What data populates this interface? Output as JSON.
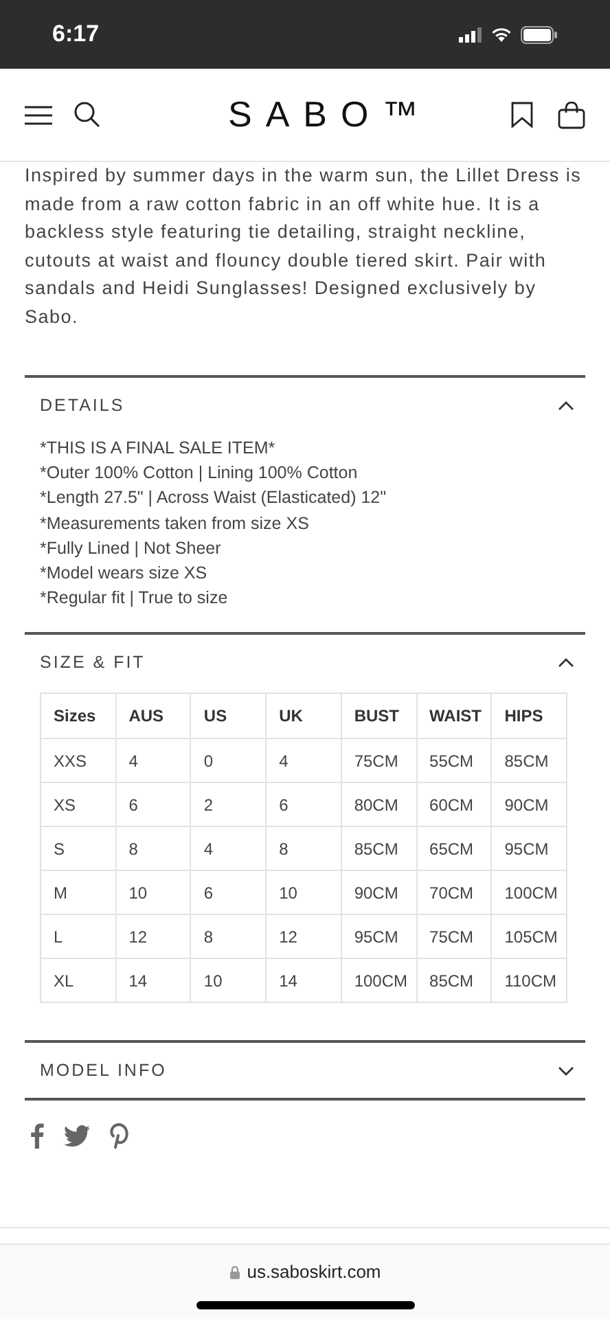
{
  "status_bar": {
    "time": "6:17"
  },
  "header": {
    "logo": "SABO™"
  },
  "description": "Inspired by summer days in the warm sun, the Lillet Dress is made from a raw cotton fabric in an off white hue. It is a backless style featuring tie detailing, straight neckline, cutouts at waist and flouncy double tiered skirt. Pair with sandals and Heidi Sunglasses! Designed exclusively by Sabo.",
  "sections": [
    {
      "kind": "list",
      "title": "DETAILS",
      "expanded": true,
      "items": [
        "*THIS IS A FINAL SALE ITEM*",
        "*Outer 100% Cotton | Lining 100% Cotton",
        "*Length 27.5\" | Across Waist (Elasticated) 12\"",
        "*Measurements taken from size XS",
        "*Fully Lined | Not Sheer",
        "*Model wears size XS",
        "*Regular fit | True to size"
      ]
    },
    {
      "kind": "table",
      "title": "SIZE & FIT",
      "expanded": true,
      "table": {
        "columns": [
          "Sizes",
          "AUS",
          "US",
          "UK",
          "BUST",
          "WAIST",
          "HIPS"
        ],
        "rows": [
          [
            "XXS",
            "4",
            "0",
            "4",
            "75CM",
            "55CM",
            "85CM"
          ],
          [
            "XS",
            "6",
            "2",
            "6",
            "80CM",
            "60CM",
            "90CM"
          ],
          [
            "S",
            "8",
            "4",
            "8",
            "85CM",
            "65CM",
            "95CM"
          ],
          [
            "M",
            "10",
            "6",
            "10",
            "90CM",
            "70CM",
            "100CM"
          ],
          [
            "L",
            "12",
            "8",
            "12",
            "95CM",
            "75CM",
            "105CM"
          ],
          [
            "XL",
            "14",
            "10",
            "14",
            "100CM",
            "85CM",
            "110CM"
          ]
        ]
      }
    },
    {
      "title": "MODEL INFO",
      "expanded": false
    }
  ],
  "browser_bar": {
    "url": "us.saboskirt.com"
  }
}
